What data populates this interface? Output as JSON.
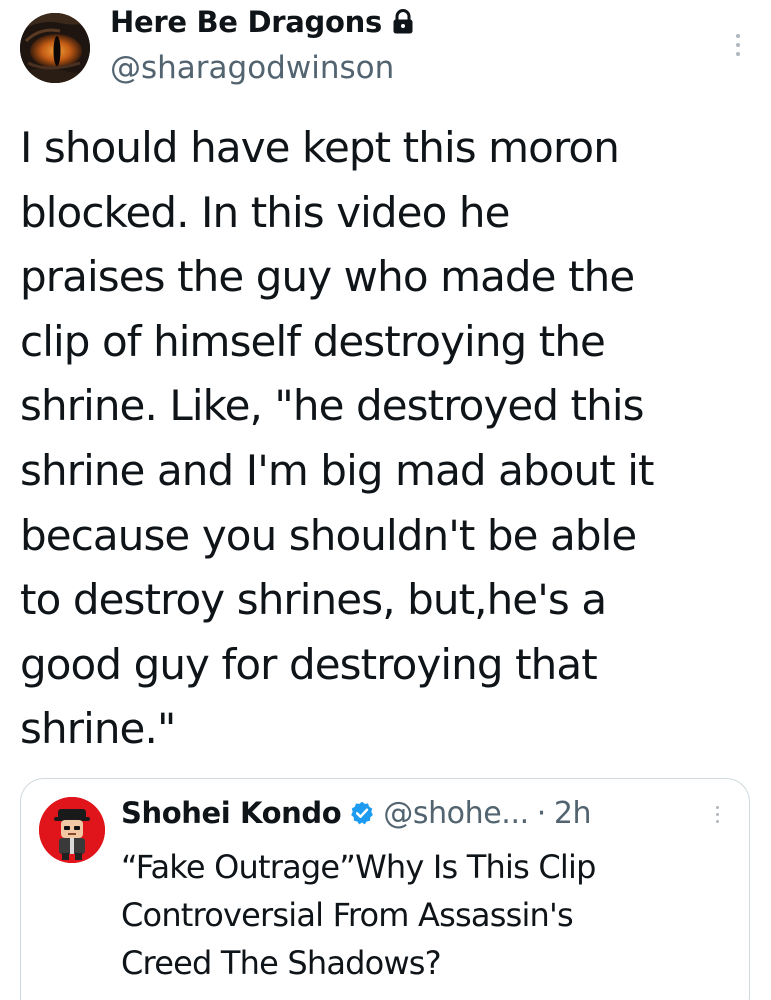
{
  "tweet": {
    "author": {
      "display_name": "Here Be Dragons",
      "handle": "@sharagodwinson",
      "protected_icon": "lock-icon",
      "avatar_icon": "dragon-eye-avatar"
    },
    "more_icon": "more-vertical-icon",
    "text_lines": [
      "I should have kept this moron",
      "blocked. In this video he",
      "praises the guy who made the",
      "clip of himself destroying the",
      "shrine. Like, \"he destroyed this",
      "shrine and I'm big mad about it",
      "because you shouldn't be able",
      "to destroy shrines, but,he's a",
      "good guy for destroying that",
      "shrine.\""
    ]
  },
  "quoted_tweet": {
    "author": {
      "display_name": "Shohei Kondo",
      "handle": "@shohe...",
      "separator": "·",
      "time": "2h",
      "verified_icon": "verified-badge-icon",
      "avatar_icon": "cartoon-character-avatar"
    },
    "more_icon": "more-vertical-icon",
    "text_lines": [
      "“Fake Outrage”Why Is This Clip",
      "Controversial From Assassin's",
      "Creed The Shadows?"
    ]
  },
  "colors": {
    "text_primary": "#0f1419",
    "text_secondary": "#536471",
    "border": "#cfd9de",
    "verified_blue": "#1d9bf0",
    "quote_avatar_bg": "#e0151b"
  }
}
